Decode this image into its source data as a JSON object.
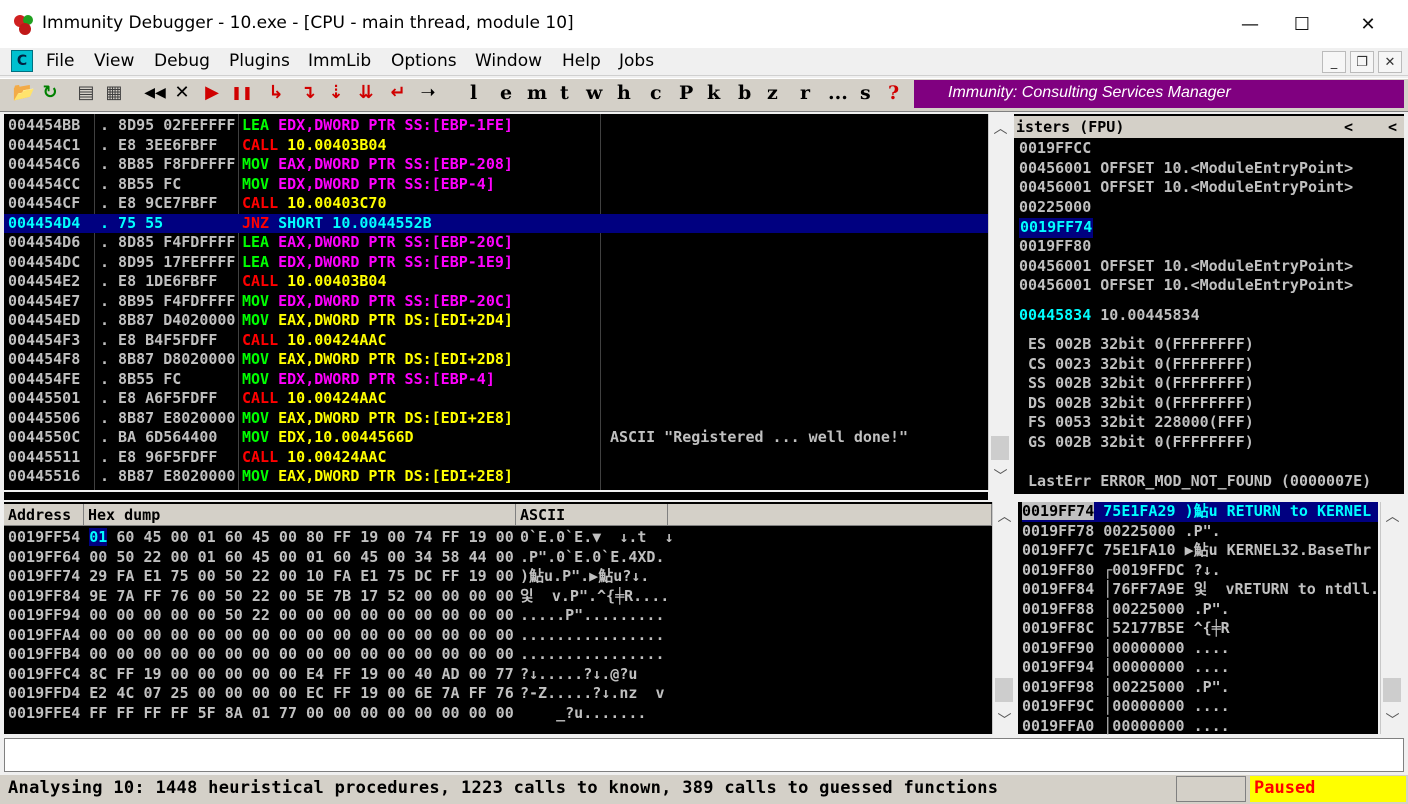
{
  "window": {
    "title": "Immunity Debugger - 10.exe - [CPU - main thread, module 10]",
    "minimize_glyph": "—",
    "maximize_glyph": "☐",
    "close_glyph": "✕"
  },
  "menu": {
    "icon_letter": "C",
    "items": [
      "File",
      "View",
      "Debug",
      "Plugins",
      "ImmLib",
      "Options",
      "Window",
      "Help",
      "Jobs"
    ],
    "mdi_buttons": [
      "_",
      "❐",
      "✕"
    ]
  },
  "toolbar": {
    "icons": [
      {
        "name": "open-icon",
        "glyph": "📂",
        "color": "#c8a000"
      },
      {
        "name": "restart-icon",
        "glyph": "↻",
        "color": "#008000"
      },
      {
        "name": "window-icon",
        "glyph": "▤",
        "color": "#404040"
      },
      {
        "name": "hex-icon",
        "glyph": "▦",
        "color": "#404040"
      },
      {
        "name": "rewind-icon",
        "glyph": "◀◀",
        "color": "#000000"
      },
      {
        "name": "close-process-icon",
        "glyph": "✕",
        "color": "#000000"
      },
      {
        "name": "run-icon",
        "glyph": "▶",
        "color": "#d00000"
      },
      {
        "name": "pause-icon",
        "glyph": "❚❚",
        "color": "#d00000"
      },
      {
        "name": "step-into-icon",
        "glyph": "↳",
        "color": "#d00000"
      },
      {
        "name": "step-over-icon",
        "glyph": "↴",
        "color": "#d00000"
      },
      {
        "name": "trace-into-icon",
        "glyph": "⇣",
        "color": "#d00000"
      },
      {
        "name": "trace-over-icon",
        "glyph": "⇊",
        "color": "#d00000"
      },
      {
        "name": "execute-till-return-icon",
        "glyph": "↵",
        "color": "#d00000"
      },
      {
        "name": "goto-icon",
        "glyph": "➝",
        "color": "#000000"
      }
    ],
    "letters": [
      "l",
      "e",
      "m",
      "t",
      "w",
      "h",
      "c",
      "P",
      "k",
      "b",
      "z",
      "r",
      "...",
      "s",
      "?"
    ],
    "brand": "Immunity: Consulting Services Manager",
    "brand_color": "#800080"
  },
  "disasm": {
    "rows": [
      {
        "addr": "004454BB",
        "hex": ". 8D95 02FEFFFF",
        "mn": "LEA",
        "ops": "EDX,DWORD PTR SS:[EBP-1FE]",
        "kind": "lea_ss",
        "comment": ""
      },
      {
        "addr": "004454C1",
        "hex": ". E8 3EE6FBFF",
        "mn": "CALL",
        "ops": "10.00403B04",
        "kind": "call",
        "comment": ""
      },
      {
        "addr": "004454C6",
        "hex": ". 8B85 F8FDFFFF",
        "mn": "MOV",
        "ops": "EAX,DWORD PTR SS:[EBP-208]",
        "kind": "mov_ss",
        "comment": ""
      },
      {
        "addr": "004454CC",
        "hex": ". 8B55 FC",
        "mn": "MOV",
        "ops": "EDX,DWORD PTR SS:[EBP-4]",
        "kind": "mov_ss",
        "comment": ""
      },
      {
        "addr": "004454CF",
        "hex": ". E8 9CE7FBFF",
        "mn": "CALL",
        "ops": "10.00403C70",
        "kind": "call",
        "comment": ""
      },
      {
        "addr": "004454D4",
        "hex": ". 75 55",
        "mn": "JNZ",
        "ops": "SHORT 10.0044552B",
        "kind": "jnz",
        "comment": "",
        "selected": true
      },
      {
        "addr": "004454D6",
        "hex": ". 8D85 F4FDFFFF",
        "mn": "LEA",
        "ops": "EAX,DWORD PTR SS:[EBP-20C]",
        "kind": "lea_ss",
        "comment": ""
      },
      {
        "addr": "004454DC",
        "hex": ". 8D95 17FEFFFF",
        "mn": "LEA",
        "ops": "EDX,DWORD PTR SS:[EBP-1E9]",
        "kind": "lea_ss",
        "comment": ""
      },
      {
        "addr": "004454E2",
        "hex": ". E8 1DE6FBFF",
        "mn": "CALL",
        "ops": "10.00403B04",
        "kind": "call",
        "comment": ""
      },
      {
        "addr": "004454E7",
        "hex": ". 8B95 F4FDFFFF",
        "mn": "MOV",
        "ops": "EDX,DWORD PTR SS:[EBP-20C]",
        "kind": "mov_ss",
        "comment": ""
      },
      {
        "addr": "004454ED",
        "hex": ". 8B87 D4020000",
        "mn": "MOV",
        "ops": "EAX,DWORD PTR DS:[EDI+2D4]",
        "kind": "mov_ds",
        "comment": ""
      },
      {
        "addr": "004454F3",
        "hex": ". E8 B4F5FDFF",
        "mn": "CALL",
        "ops": "10.00424AAC",
        "kind": "call",
        "comment": ""
      },
      {
        "addr": "004454F8",
        "hex": ". 8B87 D8020000",
        "mn": "MOV",
        "ops": "EAX,DWORD PTR DS:[EDI+2D8]",
        "kind": "mov_ds",
        "comment": ""
      },
      {
        "addr": "004454FE",
        "hex": ". 8B55 FC",
        "mn": "MOV",
        "ops": "EDX,DWORD PTR SS:[EBP-4]",
        "kind": "mov_ss",
        "comment": ""
      },
      {
        "addr": "00445501",
        "hex": ". E8 A6F5FDFF",
        "mn": "CALL",
        "ops": "10.00424AAC",
        "kind": "call",
        "comment": ""
      },
      {
        "addr": "00445506",
        "hex": ". 8B87 E8020000",
        "mn": "MOV",
        "ops": "EAX,DWORD PTR DS:[EDI+2E8]",
        "kind": "mov_ds",
        "comment": ""
      },
      {
        "addr": "0044550C",
        "hex": ". BA 6D564400",
        "mn": "MOV",
        "ops": "EDX,10.0044566D",
        "kind": "mov_imm",
        "comment": "ASCII \"Registered ... well done!\""
      },
      {
        "addr": "00445511",
        "hex": ". E8 96F5FDFF",
        "mn": "CALL",
        "ops": "10.00424AAC",
        "kind": "call",
        "comment": ""
      },
      {
        "addr": "00445516",
        "hex": ". 8B87 E8020000",
        "mn": "MOV",
        "ops": "EAX,DWORD PTR DS:[EDI+2E8]",
        "kind": "mov_ds",
        "comment": ""
      }
    ]
  },
  "registers": {
    "header": "isters (FPU)",
    "header_arrows": [
      "<",
      "<"
    ],
    "lines": [
      {
        "text": "0019FFCC"
      },
      {
        "text": "00456001 OFFSET 10.<ModuleEntryPoint>"
      },
      {
        "text": "00456001 OFFSET 10.<ModuleEntryPoint>"
      },
      {
        "text": "00225000"
      },
      {
        "text": "0019FF74",
        "highlight": true
      },
      {
        "text": "0019FF80"
      },
      {
        "text": "00456001 OFFSET 10.<ModuleEntryPoint>"
      },
      {
        "text": "00456001 OFFSET 10.<ModuleEntryPoint>"
      },
      {
        "text": ""
      },
      {
        "text": "00445834 10.00445834",
        "cyan_prefix": "00445834"
      },
      {
        "text": ""
      },
      {
        "text": " ES 002B 32bit 0(FFFFFFFF)"
      },
      {
        "text": " CS 0023 32bit 0(FFFFFFFF)"
      },
      {
        "text": " SS 002B 32bit 0(FFFFFFFF)"
      },
      {
        "text": " DS 002B 32bit 0(FFFFFFFF)"
      },
      {
        "text": " FS 0053 32bit 228000(FFF)"
      },
      {
        "text": " GS 002B 32bit 0(FFFFFFFF)"
      },
      {
        "text": ""
      },
      {
        "text": " LastErr ERROR_MOD_NOT_FOUND (0000007E)"
      }
    ]
  },
  "dump": {
    "headers": [
      "Address",
      "Hex dump",
      "ASCII"
    ],
    "rows": [
      {
        "addr": "0019FF54",
        "first": "01",
        "hex": " 60 45 00 01 60 45 00 80 FF 19 00 74 FF 19 00",
        "ascii": "0`E.0`E.▼  ↓.t  ↓"
      },
      {
        "addr": "0019FF64",
        "first": "00",
        "hex": " 50 22 00 01 60 45 00 01 60 45 00 34 58 44 00",
        "ascii": ".P\".0`E.0`E.4XD."
      },
      {
        "addr": "0019FF74",
        "first": "29",
        "hex": " FA E1 75 00 50 22 00 10 FA E1 75 DC FF 19 00",
        "ascii": ")鮎u.P\".▶鮎u?↓."
      },
      {
        "addr": "0019FF84",
        "first": "9E",
        "hex": " 7A FF 76 00 50 22 00 5E 7B 17 52 00 00 00 00",
        "ascii": "잋  v.P\".^{╪R...."
      },
      {
        "addr": "0019FF94",
        "first": "00",
        "hex": " 00 00 00 00 50 22 00 00 00 00 00 00 00 00 00",
        "ascii": ".....P\"........."
      },
      {
        "addr": "0019FFA4",
        "first": "00",
        "hex": " 00 00 00 00 00 00 00 00 00 00 00 00 00 00 00",
        "ascii": "................"
      },
      {
        "addr": "0019FFB4",
        "first": "00",
        "hex": " 00 00 00 00 00 00 00 00 00 00 00 00 00 00 00",
        "ascii": "................"
      },
      {
        "addr": "0019FFC4",
        "first": "8C",
        "hex": " FF 19 00 00 00 00 00 E4 FF 19 00 40 AD 00 77",
        "ascii": "?↓.....?↓.@?u"
      },
      {
        "addr": "0019FFD4",
        "first": "E2",
        "hex": " 4C 07 25 00 00 00 00 EC FF 19 00 6E 7A FF 76",
        "ascii": "?-Z.....?↓.nz  v"
      },
      {
        "addr": "0019FFE4",
        "first": "FF",
        "hex": " FF FF FF 5F 8A 01 77 00 00 00 00 00 00 00 00",
        "ascii": "    _?u......."
      }
    ]
  },
  "stack": {
    "rows": [
      {
        "addr": "0019FF74",
        "val": "75E1FA29",
        "ann": ")鮎u RETURN to KERNEL",
        "selected": true
      },
      {
        "addr": "0019FF78",
        "val": "00225000",
        "ann": ".P\"."
      },
      {
        "addr": "0019FF7C",
        "val": "75E1FA10",
        "ann": "▶鮎u KERNEL32.BaseThr"
      },
      {
        "addr": "0019FF80",
        "val": "┌0019FFDC",
        "ann": "?↓."
      },
      {
        "addr": "0019FF84",
        "val": "│76FF7A9E",
        "ann": "잋  vRETURN to ntdll."
      },
      {
        "addr": "0019FF88",
        "val": "│00225000",
        "ann": ".P\"."
      },
      {
        "addr": "0019FF8C",
        "val": "│52177B5E",
        "ann": "^{╪R"
      },
      {
        "addr": "0019FF90",
        "val": "│00000000",
        "ann": "...."
      },
      {
        "addr": "0019FF94",
        "val": "│00000000",
        "ann": "...."
      },
      {
        "addr": "0019FF98",
        "val": "│00225000",
        "ann": ".P\"."
      },
      {
        "addr": "0019FF9C",
        "val": "│00000000",
        "ann": "...."
      },
      {
        "addr": "0019FFA0",
        "val": "│00000000",
        "ann": "...."
      }
    ]
  },
  "status": {
    "text": "Analysing 10: 1448 heuristical procedures, 1223 calls to known, 389 calls to guessed functions",
    "state": "Paused"
  },
  "colors": {
    "lea": "#00ff00",
    "mov": "#00ff00",
    "call": "#ff0000",
    "jnz": "#ff0000",
    "ss_ptr": "#ff00ff",
    "ds_ptr": "#ffff00",
    "imm": "#ffff00",
    "cyan": "#00ffff"
  }
}
